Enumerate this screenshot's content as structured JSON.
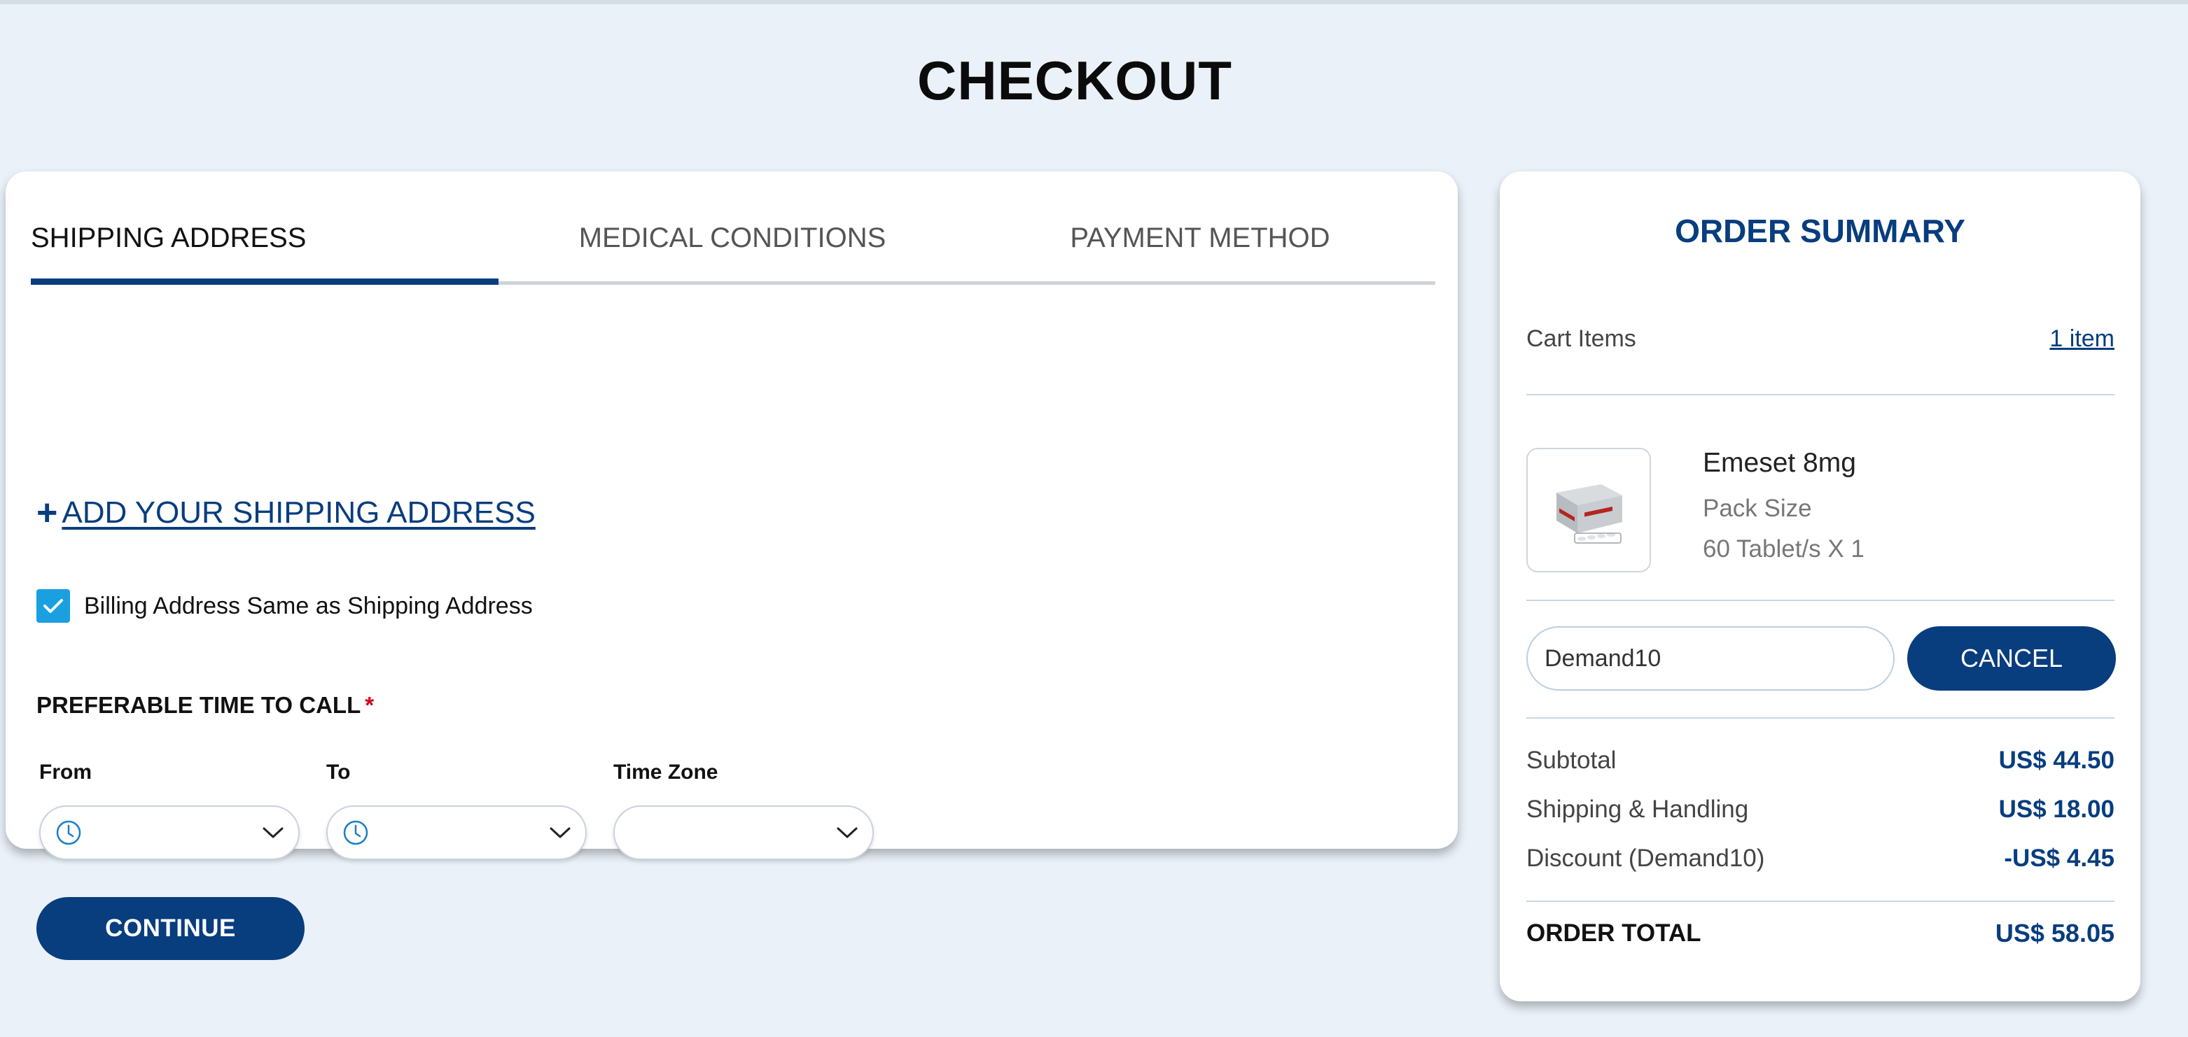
{
  "page": {
    "title": "CHECKOUT"
  },
  "tabs": [
    {
      "label": "SHIPPING ADDRESS",
      "active": true
    },
    {
      "label": "MEDICAL CONDITIONS",
      "active": false
    },
    {
      "label": "PAYMENT METHOD",
      "active": false
    }
  ],
  "shipping": {
    "add_plus": "+",
    "add_label": "ADD YOUR SHIPPING ADDRESS",
    "billing_same_label": "Billing Address Same as Shipping Address",
    "billing_same_checked": true,
    "call_time_heading": "PREFERABLE TIME TO CALL",
    "required_mark": "*",
    "from_label": "From",
    "to_label": "To",
    "timezone_label": "Time Zone",
    "from_value": "",
    "to_value": "",
    "timezone_value": "",
    "continue_label": "CONTINUE"
  },
  "summary": {
    "title": "ORDER SUMMARY",
    "cart_label": "Cart Items",
    "cart_count": "1 item",
    "product": {
      "name": "Emeset 8mg",
      "pack_label": "Pack Size",
      "pack_value": "60 Tablet/s X 1"
    },
    "coupon_value": "Demand10",
    "cancel_label": "CANCEL",
    "subtotal_label": "Subtotal",
    "subtotal_value": "US$ 44.50",
    "shipping_label": "Shipping & Handling",
    "shipping_value": "US$ 18.00",
    "discount_label": "Discount (Demand10)",
    "discount_value": "-US$ 4.45",
    "total_label": "ORDER TOTAL",
    "total_value": "US$ 58.05"
  },
  "colors": {
    "brand": "#083d7e",
    "checkbox": "#1aa0e0",
    "background": "#eaf1f8",
    "required": "#d0021b"
  },
  "icons": [
    "plus-icon",
    "check-icon",
    "clock-icon",
    "chevron-down-icon",
    "product-image"
  ]
}
